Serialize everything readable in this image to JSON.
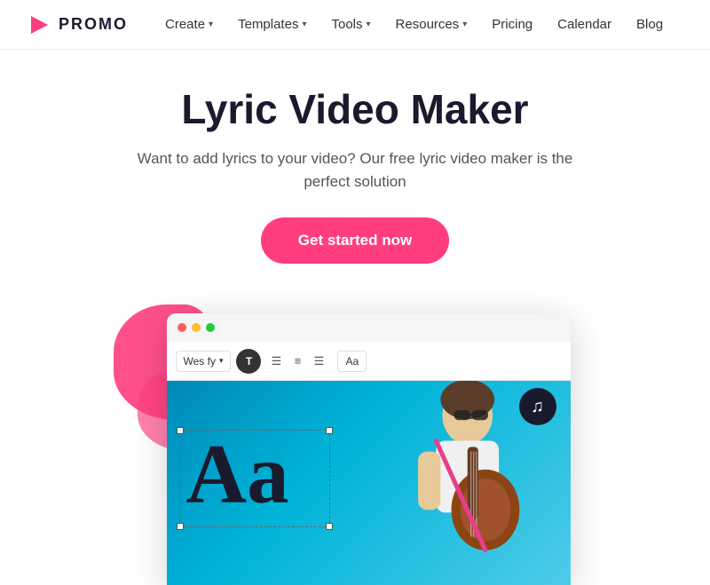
{
  "logo": {
    "text": "PROMO"
  },
  "nav": {
    "items": [
      {
        "label": "Create",
        "hasDropdown": true
      },
      {
        "label": "Templates",
        "hasDropdown": true
      },
      {
        "label": "Tools",
        "hasDropdown": true
      },
      {
        "label": "Resources",
        "hasDropdown": true
      },
      {
        "label": "Pricing",
        "hasDropdown": false
      },
      {
        "label": "Calendar",
        "hasDropdown": false
      },
      {
        "label": "Blog",
        "hasDropdown": false
      }
    ]
  },
  "hero": {
    "title": "Lyric Video Maker",
    "subtitle": "Want to add lyrics to your video? Our free lyric video maker is the perfect solution",
    "cta_label": "Get started now"
  },
  "editor": {
    "font_name": "Wes fy",
    "aa_label": "Aa",
    "big_text": "Aa",
    "music_icon": "♫"
  },
  "colors": {
    "accent": "#ff3d7f",
    "dark": "#1a1a2e",
    "canvas_bg": "#00b4d8"
  }
}
